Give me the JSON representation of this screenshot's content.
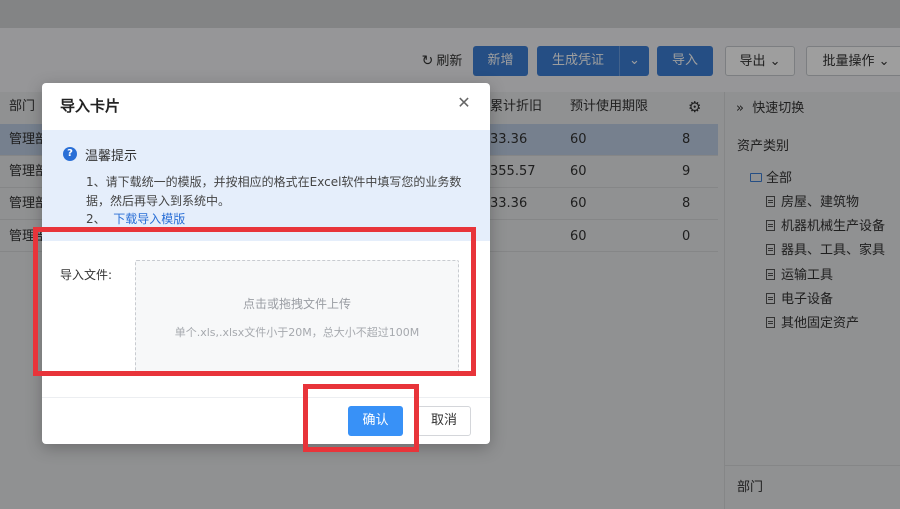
{
  "toolbar": {
    "refresh_label": "刷新",
    "new_label": "新增",
    "generate_voucher_label": "生成凭证",
    "import_label": "导入",
    "export_label": "导出",
    "batch_label": "批量操作"
  },
  "table": {
    "headers": {
      "dept": "部门",
      "accum_depr": "累计折旧",
      "expected_life": "预计使用期限"
    },
    "rows": [
      {
        "dept": "管理部",
        "accum_depr": "33.36",
        "life": "60",
        "last": "8"
      },
      {
        "dept": "管理部",
        "accum_depr": "355.57",
        "life": "60",
        "last": "9"
      },
      {
        "dept": "管理部",
        "accum_depr": "33.36",
        "life": "60",
        "last": "8"
      },
      {
        "dept": "管理部",
        "accum_depr": "",
        "life": "60",
        "last": "0"
      }
    ]
  },
  "right_panel": {
    "quick_switch": "快速切换",
    "category_title": "资产类别",
    "tree": {
      "root": "全部",
      "items": [
        "房屋、建筑物",
        "机器机械生产设备",
        "器具、工具、家具",
        "运输工具",
        "电子设备",
        "其他固定资产"
      ]
    },
    "dept_title": "部门"
  },
  "dialog": {
    "title": "导入卡片",
    "tip": {
      "title": "温馨提示",
      "line1": "1、请下载统一的模版，并按相应的格式在Excel软件中填写您的业务数",
      "line2": "据，然后再导入到系统中。",
      "line3_prefix": "2、",
      "line3_link": "下载导入模版"
    },
    "upload_label": "导入文件:",
    "dropzone_main": "点击或拖拽文件上传",
    "dropzone_sub": "单个.xls,.xlsx文件小于20M，总大小不超过100M",
    "confirm_label": "确认",
    "cancel_label": "取消"
  },
  "colors": {
    "primary": "#3891f7",
    "annotation": "#e8343a",
    "tip_bg": "#e5eefb"
  }
}
